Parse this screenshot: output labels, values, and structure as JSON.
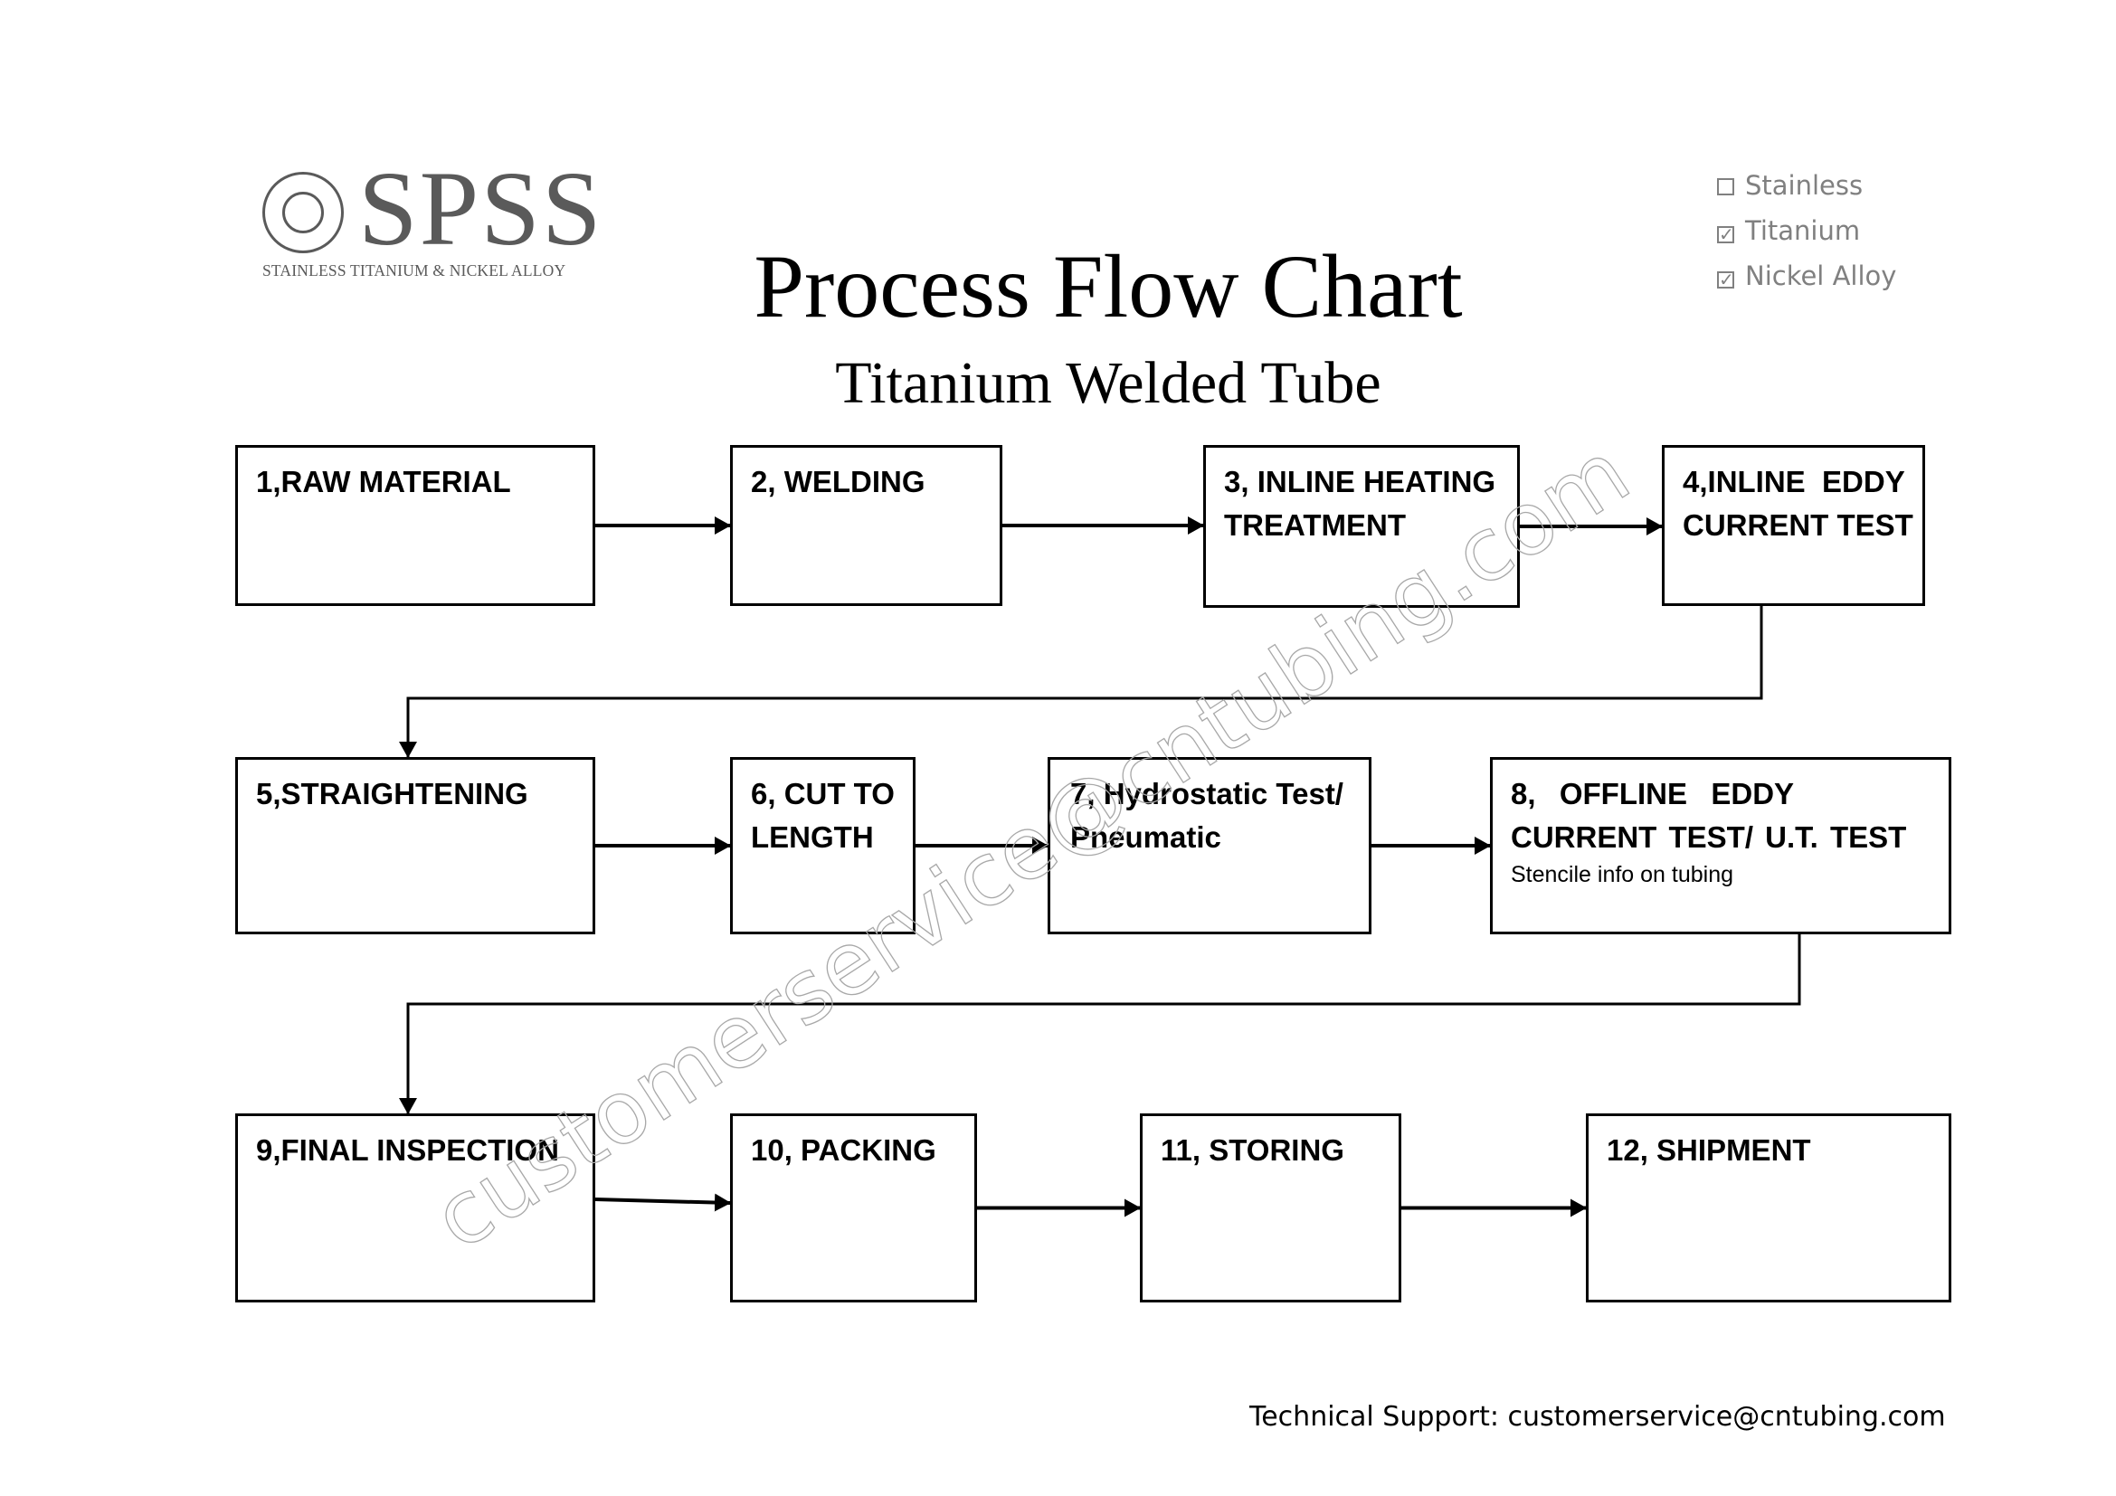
{
  "logo": {
    "wordmark": "SPSS",
    "tagline": "STAINLESS TITANIUM & NICKEL ALLOY"
  },
  "material_checklist": [
    {
      "label": "Stainless",
      "checked": false,
      "mark": ""
    },
    {
      "label": "Titanium",
      "checked": true,
      "mark": "✓"
    },
    {
      "label": "Nickel Alloy",
      "checked": true,
      "mark": "✓"
    }
  ],
  "title": "Process Flow Chart",
  "subtitle": "Titanium Welded Tube",
  "steps": [
    {
      "number": 1,
      "label": "1,RAW MATERIAL",
      "note": ""
    },
    {
      "number": 2,
      "label": "2, WELDING",
      "note": ""
    },
    {
      "number": 3,
      "label": "3, INLINE HEATING TREATMENT",
      "note": ""
    },
    {
      "number": 4,
      "label": "4,INLINE  EDDY CURRENT TEST",
      "note": ""
    },
    {
      "number": 5,
      "label": "5,STRAIGHTENING",
      "note": ""
    },
    {
      "number": 6,
      "label": "6, CUT TO LENGTH",
      "note": ""
    },
    {
      "number": 7,
      "label": "7, Hydrostatic Test/ Pneumatic",
      "note": ""
    },
    {
      "number": 8,
      "label": "8,  OFFLINE  EDDY  CURRENT TEST/ U.T. TEST",
      "note": "Stencile info on tubing"
    },
    {
      "number": 9,
      "label": "9,FINAL INSPECTION",
      "note": ""
    },
    {
      "number": 10,
      "label": "10, PACKING",
      "note": ""
    },
    {
      "number": 11,
      "label": "11, STORING",
      "note": ""
    },
    {
      "number": 12,
      "label": "12, SHIPMENT",
      "note": ""
    }
  ],
  "flow": [
    [
      1,
      2
    ],
    [
      2,
      3
    ],
    [
      3,
      4
    ],
    [
      4,
      5
    ],
    [
      5,
      6
    ],
    [
      6,
      7
    ],
    [
      7,
      8
    ],
    [
      8,
      9
    ],
    [
      9,
      10
    ],
    [
      10,
      11
    ],
    [
      11,
      12
    ]
  ],
  "watermark": "customerservice@cntubing.com",
  "footer": "Technical Support: customerservice@cntubing.com"
}
